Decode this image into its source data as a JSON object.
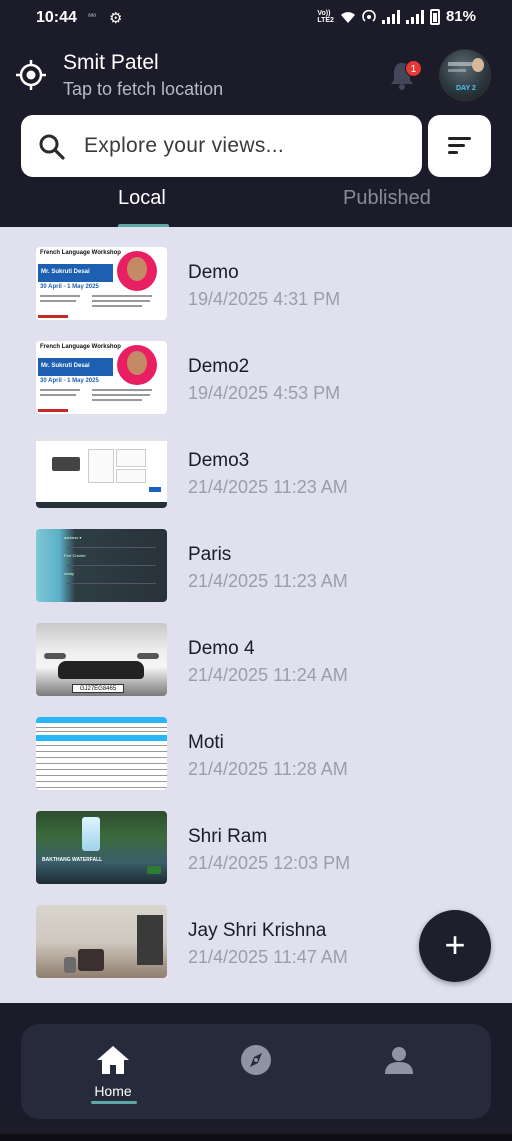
{
  "status_bar": {
    "time": "10:44",
    "small_label": "ᵃᵃᵃ",
    "volte": "Vo)) LTE2",
    "battery": "81%"
  },
  "header": {
    "user_name": "Smit Patel",
    "location_hint": "Tap to fetch location",
    "notification_count": "1"
  },
  "search": {
    "placeholder": "Explore your views..."
  },
  "tabs": [
    {
      "label": "Local",
      "active": true
    },
    {
      "label": "Published",
      "active": false
    }
  ],
  "items": [
    {
      "title": "Demo",
      "date": "19/4/2025 4:31 PM",
      "thumb": "flyer"
    },
    {
      "title": "Demo2",
      "date": "19/4/2025 4:53 PM",
      "thumb": "flyer"
    },
    {
      "title": "Demo3",
      "date": "21/4/2025 11:23 AM",
      "thumb": "screenshot"
    },
    {
      "title": "Paris",
      "date": "21/4/2025 11:23 AM",
      "thumb": "phone-screen"
    },
    {
      "title": "Demo 4",
      "date": "21/4/2025 11:24 AM",
      "thumb": "car"
    },
    {
      "title": "Moti",
      "date": "21/4/2025 11:28 AM",
      "thumb": "spreadsheet"
    },
    {
      "title": "Shri Ram",
      "date": "21/4/2025 12:03 PM",
      "thumb": "waterfall"
    },
    {
      "title": "Jay Shri Krishna",
      "date": "21/4/2025 11:47 AM",
      "thumb": "room"
    }
  ],
  "thumb_text": {
    "flyer_title": "French Language Workshop",
    "flyer_speaker": "Mr. Sukruti Desai",
    "flyer_dates": "30 April - 1 May 2025",
    "car_plate": "GJ27EG8465",
    "waterfall_caption": "BAKTHANG WATERFALL"
  },
  "fab": {
    "label": "+"
  },
  "nav": [
    {
      "label": "Home",
      "icon": "home-icon",
      "active": true
    },
    {
      "label": "",
      "icon": "compass-icon",
      "active": false
    },
    {
      "label": "",
      "icon": "person-icon",
      "active": false
    }
  ],
  "colors": {
    "background": "#1b1b29",
    "list_background": "#e0e0ee",
    "accent": "#5ea9a8",
    "badge": "#e53935"
  }
}
